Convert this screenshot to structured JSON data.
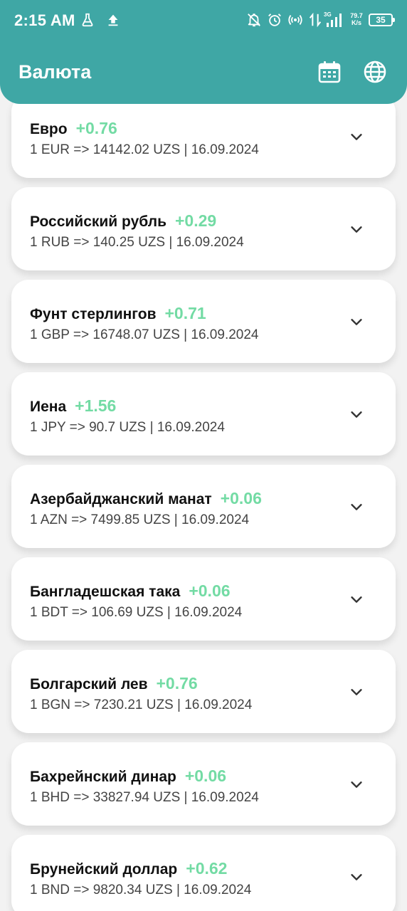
{
  "status_bar": {
    "time": "2:15 AM",
    "net_speed_value": "79.7",
    "net_speed_unit": "K/s",
    "network_type": "3G",
    "battery": "35",
    "icons": [
      "flask-icon",
      "upload-icon",
      "notifications-off-icon",
      "alarm-icon",
      "hotspot-icon",
      "data-arrows-icon",
      "signal-icon",
      "battery-icon"
    ]
  },
  "header": {
    "title": "Валюта",
    "actions": [
      "calendar-icon",
      "globe-icon"
    ],
    "color": "#3fa7a5"
  },
  "accent_positive": "#73dba4",
  "currencies": [
    {
      "name": "Евро",
      "change": "+0.76",
      "rate": "1 EUR => 14142.02 UZS |  16.09.2024"
    },
    {
      "name": "Российский рубль",
      "change": "+0.29",
      "rate": "1 RUB => 140.25 UZS |  16.09.2024"
    },
    {
      "name": "Фунт стерлингов",
      "change": "+0.71",
      "rate": "1 GBP => 16748.07 UZS |  16.09.2024"
    },
    {
      "name": "Иена",
      "change": "+1.56",
      "rate": "1 JPY => 90.7 UZS |  16.09.2024"
    },
    {
      "name": "Азербайджанский манат",
      "change": "+0.06",
      "rate": "1 AZN => 7499.85 UZS |  16.09.2024"
    },
    {
      "name": "Бангладешская така",
      "change": "+0.06",
      "rate": "1 BDT => 106.69 UZS |  16.09.2024"
    },
    {
      "name": "Болгарский лев",
      "change": "+0.76",
      "rate": "1 BGN => 7230.21 UZS |  16.09.2024"
    },
    {
      "name": "Бахрейнский динар",
      "change": "+0.06",
      "rate": "1 BHD => 33827.94 UZS |  16.09.2024"
    },
    {
      "name": "Брунейский доллар",
      "change": "+0.62",
      "rate": "1 BND => 9820.34 UZS |  16.09.2024"
    }
  ]
}
